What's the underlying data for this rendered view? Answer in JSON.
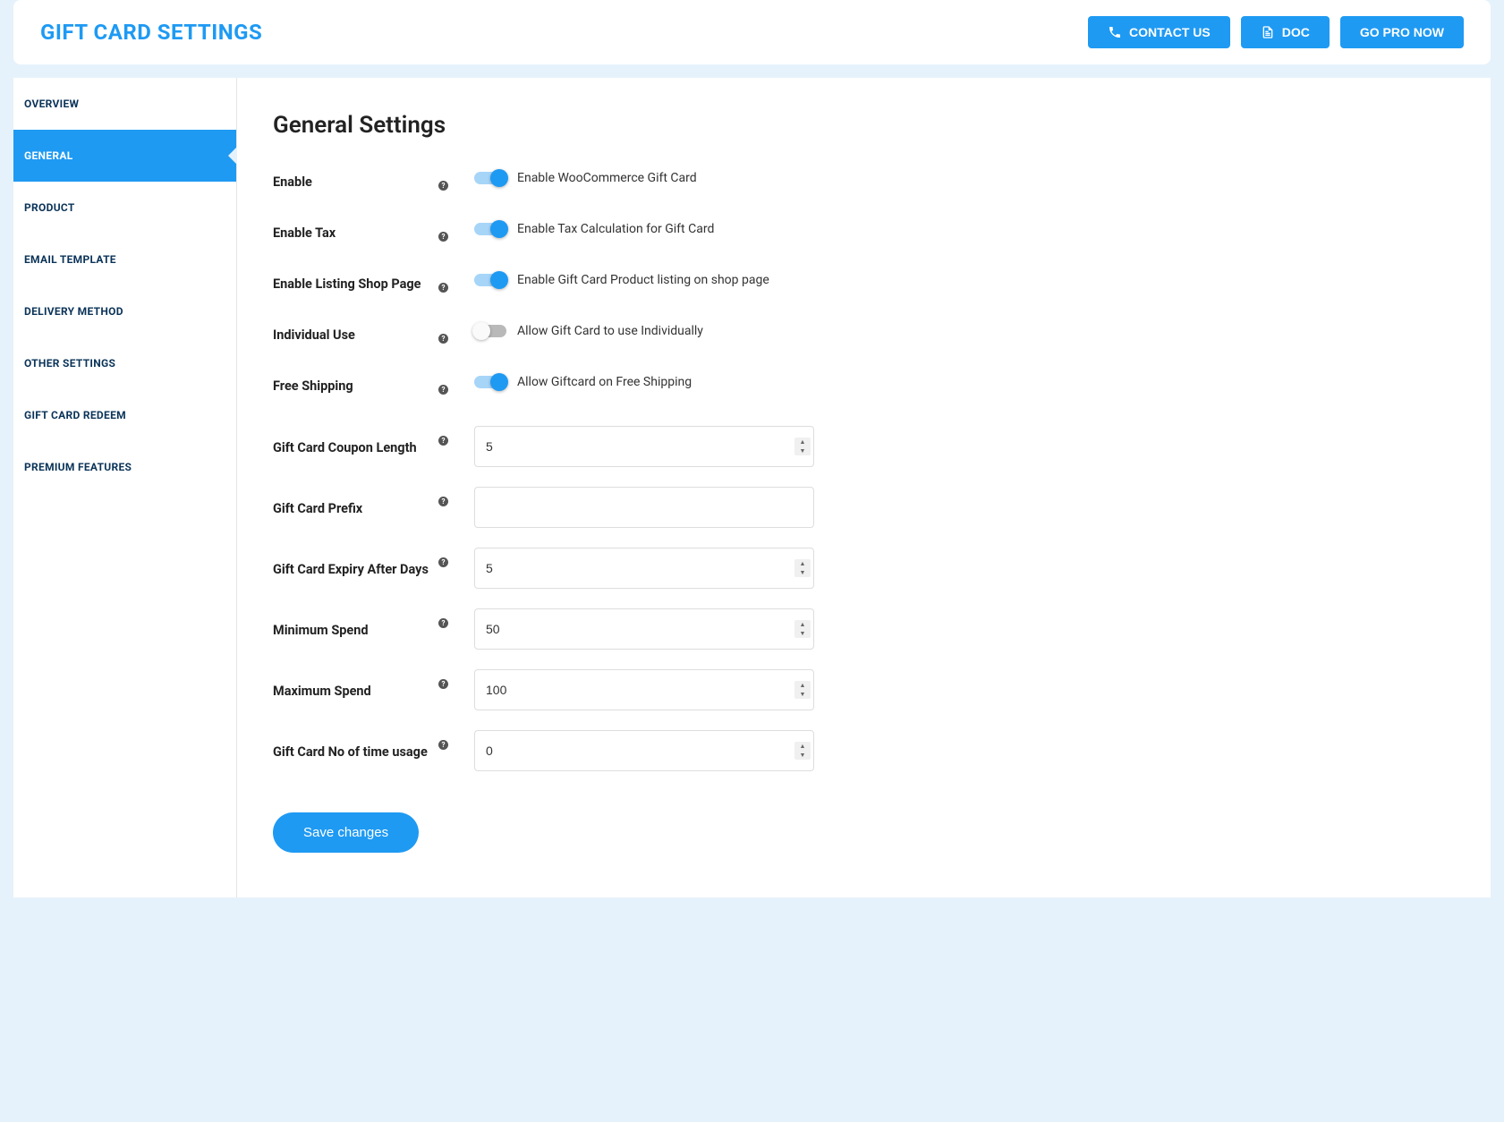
{
  "header": {
    "title": "GIFT CARD SETTINGS",
    "contact_label": "CONTACT US",
    "doc_label": "DOC",
    "pro_label": "GO PRO NOW"
  },
  "sidebar": {
    "items": [
      {
        "label": "OVERVIEW",
        "active": false
      },
      {
        "label": "GENERAL",
        "active": true
      },
      {
        "label": "PRODUCT",
        "active": false
      },
      {
        "label": "EMAIL TEMPLATE",
        "active": false
      },
      {
        "label": "DELIVERY METHOD",
        "active": false
      },
      {
        "label": "OTHER SETTINGS",
        "active": false
      },
      {
        "label": "GIFT CARD REDEEM",
        "active": false
      },
      {
        "label": "PREMIUM FEATURES",
        "active": false
      }
    ]
  },
  "content": {
    "heading": "General Settings",
    "toggles": {
      "enable": {
        "label": "Enable",
        "on": true,
        "desc": "Enable WooCommerce Gift Card"
      },
      "enable_tax": {
        "label": "Enable Tax",
        "on": true,
        "desc": "Enable Tax Calculation for Gift Card"
      },
      "enable_listing": {
        "label": "Enable Listing Shop Page",
        "on": true,
        "desc": "Enable Gift Card Product listing on shop page"
      },
      "individual_use": {
        "label": "Individual Use",
        "on": false,
        "desc": "Allow Gift Card to use Individually"
      },
      "free_shipping": {
        "label": "Free Shipping",
        "on": true,
        "desc": "Allow Giftcard on Free Shipping"
      }
    },
    "inputs": {
      "coupon_length": {
        "label": "Gift Card Coupon Length",
        "value": "5",
        "type": "number"
      },
      "prefix": {
        "label": "Gift Card Prefix",
        "value": "",
        "type": "text"
      },
      "expiry_days": {
        "label": "Gift Card Expiry After Days",
        "value": "5",
        "type": "number"
      },
      "min_spend": {
        "label": "Minimum Spend",
        "value": "50",
        "type": "number"
      },
      "max_spend": {
        "label": "Maximum Spend",
        "value": "100",
        "type": "number"
      },
      "usage_times": {
        "label": "Gift Card No of time usage",
        "value": "0",
        "type": "number"
      }
    },
    "save_label": "Save changes"
  }
}
